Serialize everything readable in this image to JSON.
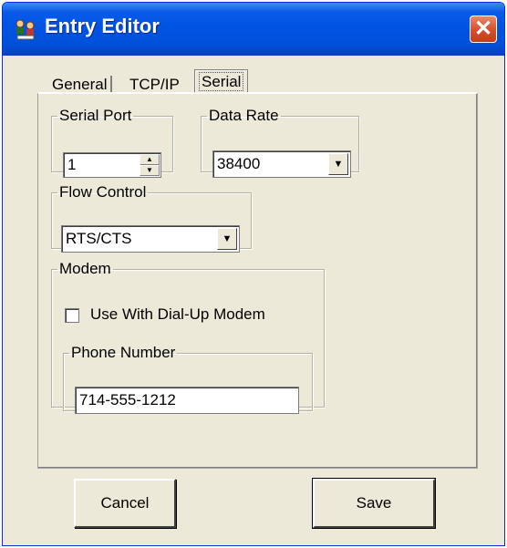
{
  "window": {
    "title": "Entry Editor",
    "close_icon": "close-icon"
  },
  "tabs": [
    {
      "label": "General"
    },
    {
      "label": "TCP/IP"
    },
    {
      "label": "Serial",
      "selected": true
    }
  ],
  "serial_port": {
    "legend": "Serial Port",
    "value": "1"
  },
  "data_rate": {
    "legend": "Data Rate",
    "value": "38400"
  },
  "flow_control": {
    "legend": "Flow Control",
    "value": "RTS/CTS"
  },
  "modem": {
    "legend": "Modem",
    "checkbox_label": "Use With Dial-Up Modem",
    "checked": false,
    "phone_legend": "Phone Number",
    "phone_value": "714-555-1212"
  },
  "buttons": {
    "cancel": "Cancel",
    "save": "Save"
  }
}
